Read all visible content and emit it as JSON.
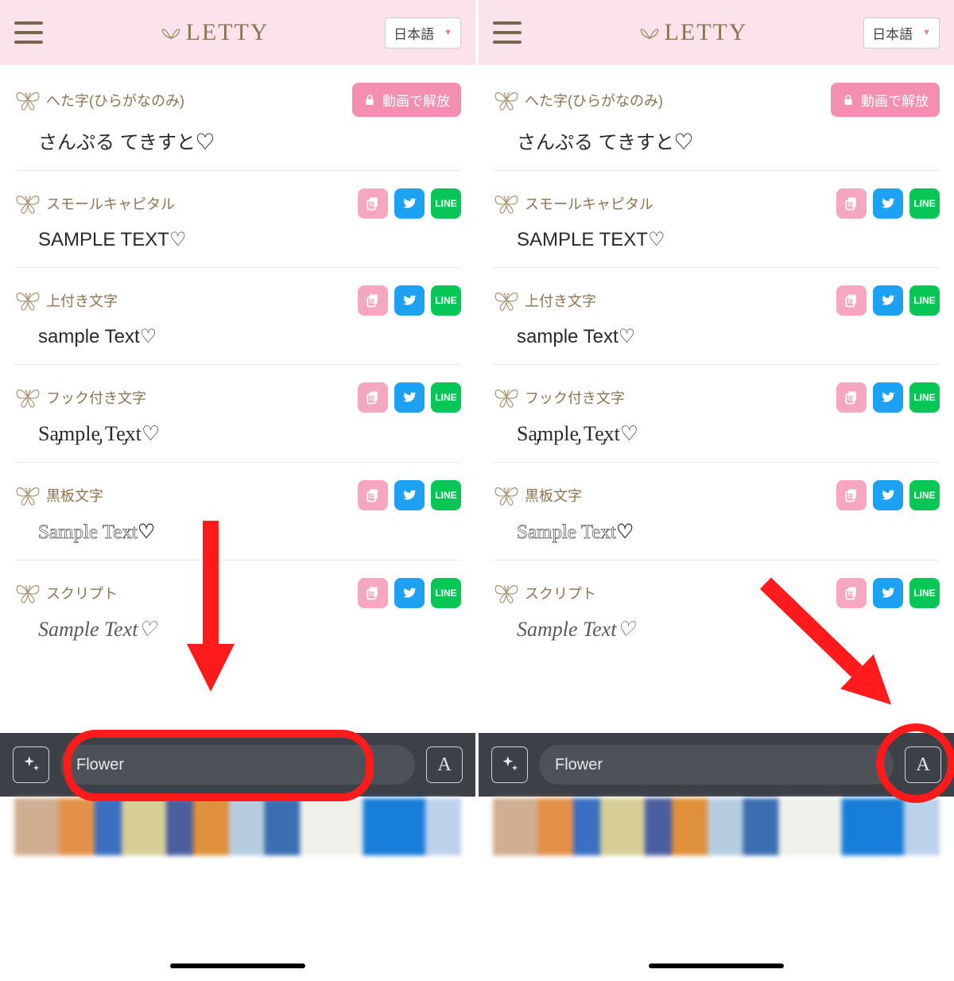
{
  "header": {
    "logo_text": "LETTY",
    "lang_label": "日本語"
  },
  "unlock_button_label": "動画で解放",
  "line_label": "LINE",
  "fonts": [
    {
      "title": "へた字(ひらがなのみ)",
      "sample": "さんぷる てきすと♡",
      "locked": true,
      "sample_class": ""
    },
    {
      "title": "スモールキャピタル",
      "sample": "SAMPLE TEXT♡",
      "locked": false,
      "sample_class": ""
    },
    {
      "title": "上付き文字",
      "sample": "sample Text♡",
      "locked": false,
      "sample_class": ""
    },
    {
      "title": "フック付き文字",
      "sample": "Sa̡mple̡ Te̡xt♡",
      "locked": false,
      "sample_class": "hook"
    },
    {
      "title": "黒板文字",
      "sample": "Sample Text♡",
      "locked": false,
      "sample_class": "bb"
    },
    {
      "title": "スクリプト",
      "sample": "Sample Text♡",
      "locked": false,
      "sample_class": "script"
    }
  ],
  "input_value": "Flower",
  "style_button_glyph": "A",
  "annotations": {
    "left": {
      "target": "input-field"
    },
    "right": {
      "target": "style-button"
    }
  }
}
